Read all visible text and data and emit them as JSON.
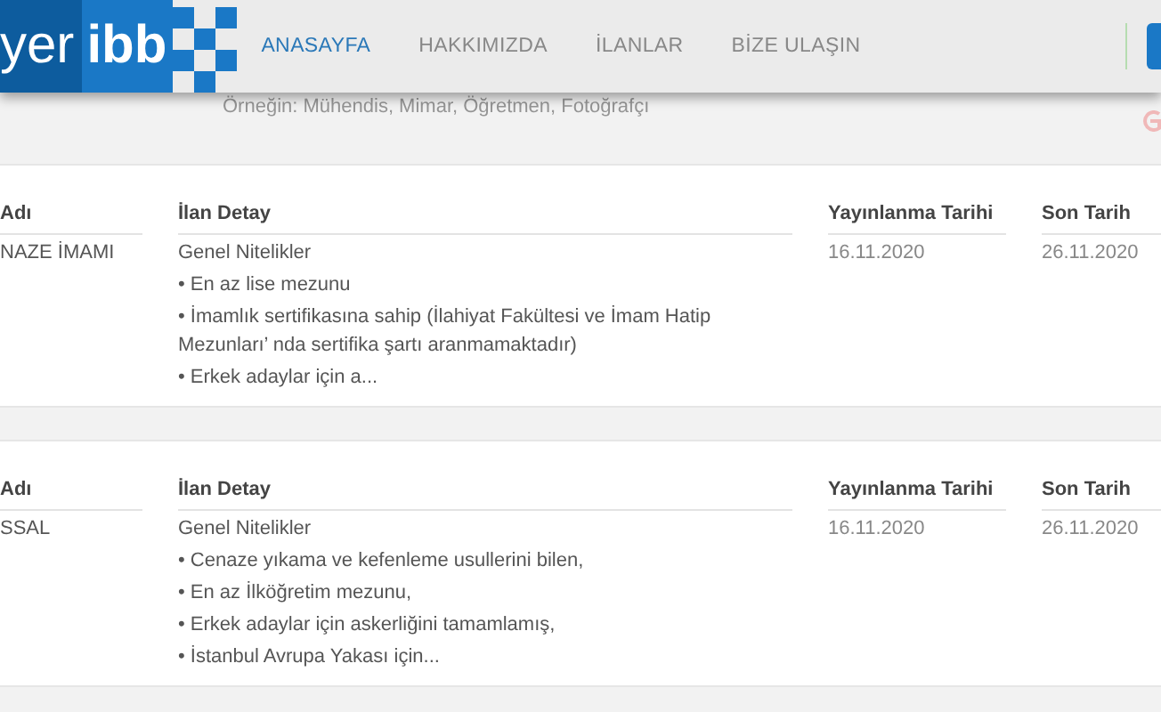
{
  "header": {
    "logo": {
      "left": "yer",
      "right": "ibb"
    },
    "nav": [
      {
        "label": "ANASAYFA",
        "selected": true
      },
      {
        "label": "HAKKIMIZDA",
        "selected": false
      },
      {
        "label": "İLANLAR",
        "selected": false
      },
      {
        "label": "BİZE ULAŞIN",
        "selected": false
      }
    ]
  },
  "search": {
    "placeholder": "Örneğin: Mühendis, Mimar, Öğretmen, Fotoğrafçı"
  },
  "listings": [
    {
      "columns": [
        "Adı",
        "İlan Detay",
        "Yayınlanma Tarihi",
        "Son Tarih"
      ],
      "name": "NAZE İMAMI",
      "detail_title": "Genel Nitelikler",
      "lines": [
        "• En az lise mezunu",
        "• İmamlık sertifikasına sahip (İlahiyat Fakültesi ve İmam Hatip Mezunları’ nda sertifika şartı aranmamaktadır)",
        "• Erkek adaylar için a..."
      ],
      "published": "16.11.2020",
      "deadline": "26.11.2020"
    },
    {
      "columns": [
        "Adı",
        "İlan Detay",
        "Yayınlanma Tarihi",
        "Son Tarih"
      ],
      "name": "SSAL",
      "detail_title": "Genel Nitelikler",
      "lines": [
        "• Cenaze yıkama ve kefenleme usullerini bilen,",
        "• En az İlköğretim mezunu,",
        "• Erkek adaylar için askerliğini tamamlamış,",
        "• İstanbul Avrupa Yakası için..."
      ],
      "published": "16.11.2020",
      "deadline": "26.11.2020"
    }
  ]
}
